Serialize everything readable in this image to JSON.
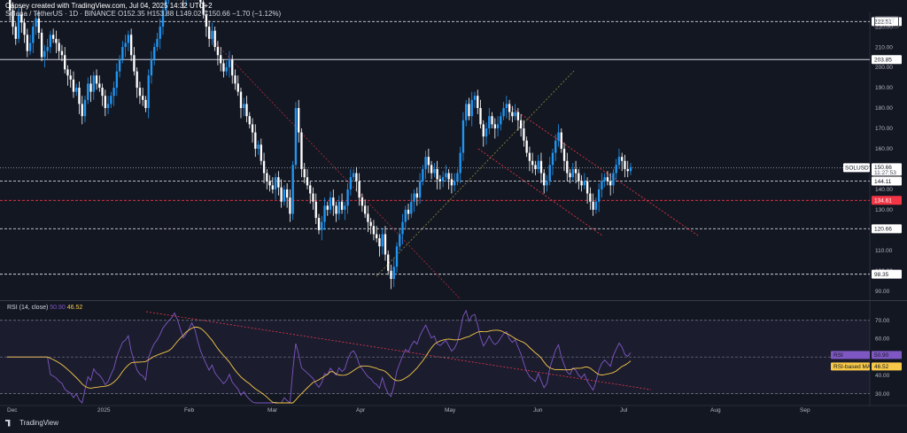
{
  "header": {
    "author_line": "Capsey created with TradingView.com, Jul 04, 2025 14:32 UTC+2",
    "symbol_line": "Solana / TetherUS · 1D · BINANCE",
    "ohlc": "O152.35 H153.88 L149.02 C150.66 −1.70 (−1.12%)"
  },
  "currency_button": "USDT",
  "footer": {
    "brand": "TradingView"
  },
  "colors": {
    "up": "#2196f3",
    "down": "#ffffff",
    "bg": "#131722",
    "rsi": "#7e57c2",
    "rsi_ma": "#f7c948",
    "trend": "#b22a3c",
    "channel": "#f23645"
  },
  "chart_data": [
    {
      "type": "candlestick",
      "symbol": "SOLUSDT",
      "interval": "1D",
      "x_tick_labels": [
        "Dec",
        "2025",
        "Feb",
        "Mar",
        "Apr",
        "May",
        "Jun",
        "Jul",
        "Aug",
        "Sep"
      ],
      "y_tick_labels": [
        "90.00",
        "100.00",
        "110.00",
        "120.00",
        "130.00",
        "140.00",
        "150.00",
        "160.00",
        "170.00",
        "180.00",
        "190.00",
        "200.00",
        "210.00",
        "220.00"
      ],
      "ylim": [
        86,
        227
      ],
      "price_tag": {
        "label": "SOLUSDT",
        "value": "150.66",
        "countdown": "11:27:53"
      },
      "horizontal_levels": [
        {
          "value": "222.51",
          "style": "dashed"
        },
        {
          "value": "203.85",
          "style": "solid"
        },
        {
          "value": "144.11",
          "style": "dashed"
        },
        {
          "value": "134.61",
          "style": "dashed-red"
        },
        {
          "value": "120.66",
          "style": "dashed"
        },
        {
          "value": "98.35",
          "style": "dashed"
        }
      ],
      "closes": [
        235,
        228,
        220,
        214,
        226,
        222,
        216,
        208,
        212,
        220,
        224,
        217,
        205,
        208,
        210,
        216,
        214,
        212,
        208,
        206,
        199,
        196,
        194,
        188,
        190,
        182,
        176,
        184,
        192,
        188,
        196,
        192,
        190,
        186,
        180,
        182,
        186,
        190,
        198,
        204,
        210,
        212,
        216,
        206,
        198,
        190,
        186,
        184,
        180,
        196,
        204,
        210,
        214,
        220,
        228,
        233,
        238,
        242,
        250,
        246,
        240,
        234,
        238,
        244,
        252,
        248,
        240,
        232,
        226,
        220,
        214,
        218,
        210,
        206,
        202,
        198,
        200,
        204,
        196,
        192,
        188,
        180,
        182,
        176,
        172,
        168,
        160,
        162,
        154,
        148,
        144,
        142,
        140,
        146,
        141,
        134,
        140,
        136,
        128,
        152,
        180,
        168,
        150,
        146,
        142,
        138,
        134,
        126,
        120,
        124,
        132,
        130,
        136,
        132,
        128,
        134,
        130,
        132,
        140,
        146,
        148,
        144,
        136,
        132,
        128,
        124,
        122,
        118,
        116,
        112,
        118,
        108,
        100,
        96,
        102,
        112,
        118,
        124,
        130,
        128,
        134,
        138,
        136,
        144,
        150,
        156,
        152,
        148,
        150,
        145,
        144,
        146,
        148,
        145,
        142,
        144,
        148,
        158,
        174,
        182,
        176,
        184,
        186,
        180,
        172,
        166,
        170,
        176,
        172,
        170,
        172,
        176,
        180,
        182,
        178,
        176,
        178,
        174,
        170,
        164,
        158,
        154,
        152,
        150,
        154,
        148,
        142,
        144,
        152,
        158,
        164,
        168,
        160,
        154,
        148,
        146,
        150,
        148,
        144,
        142,
        144,
        138,
        134,
        130,
        134,
        140,
        144,
        146,
        144,
        142,
        148,
        152,
        156,
        154,
        150,
        149,
        151
      ],
      "annotations": {
        "descending_trendline": "dotted red from Dec high through mid-April",
        "ascending_trendline": "dotted olive from April low",
        "descending_channel": "dotted red parallel channel from May high"
      }
    },
    {
      "type": "line",
      "title": "RSI (14, close)",
      "series": [
        {
          "name": "RSI",
          "last": "50.90",
          "color": "#7e57c2"
        },
        {
          "name": "RSI-based MA",
          "last": "46.52",
          "color": "#f7c948"
        }
      ],
      "y_tick_labels": [
        "30.00",
        "40.00",
        "50.00",
        "60.00",
        "70.00"
      ],
      "ylim": [
        25,
        80
      ],
      "band": [
        30,
        70
      ],
      "midline": 50
    }
  ]
}
